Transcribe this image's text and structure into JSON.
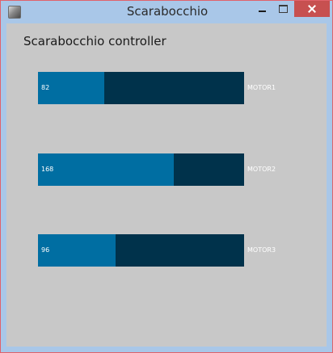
{
  "window": {
    "title": "Scarabocchio",
    "icons": [
      "app-icon",
      "minimize-icon",
      "maximize-icon",
      "close-icon"
    ]
  },
  "main": {
    "heading": "Scarabocchio controller",
    "sliders": [
      {
        "label": "MOTOR1",
        "value": "82",
        "range": [
          0,
          255
        ]
      },
      {
        "label": "MOTOR2",
        "value": "168",
        "range": [
          0,
          255
        ]
      },
      {
        "label": "MOTOR3",
        "value": "96",
        "range": [
          0,
          255
        ]
      }
    ]
  },
  "colors": {
    "slider_background": "#00324b",
    "slider_fill": "#006ea2",
    "panel_background": "#c8c8c8",
    "titlebar": "#a9c7e8",
    "close_button": "#c75050"
  }
}
